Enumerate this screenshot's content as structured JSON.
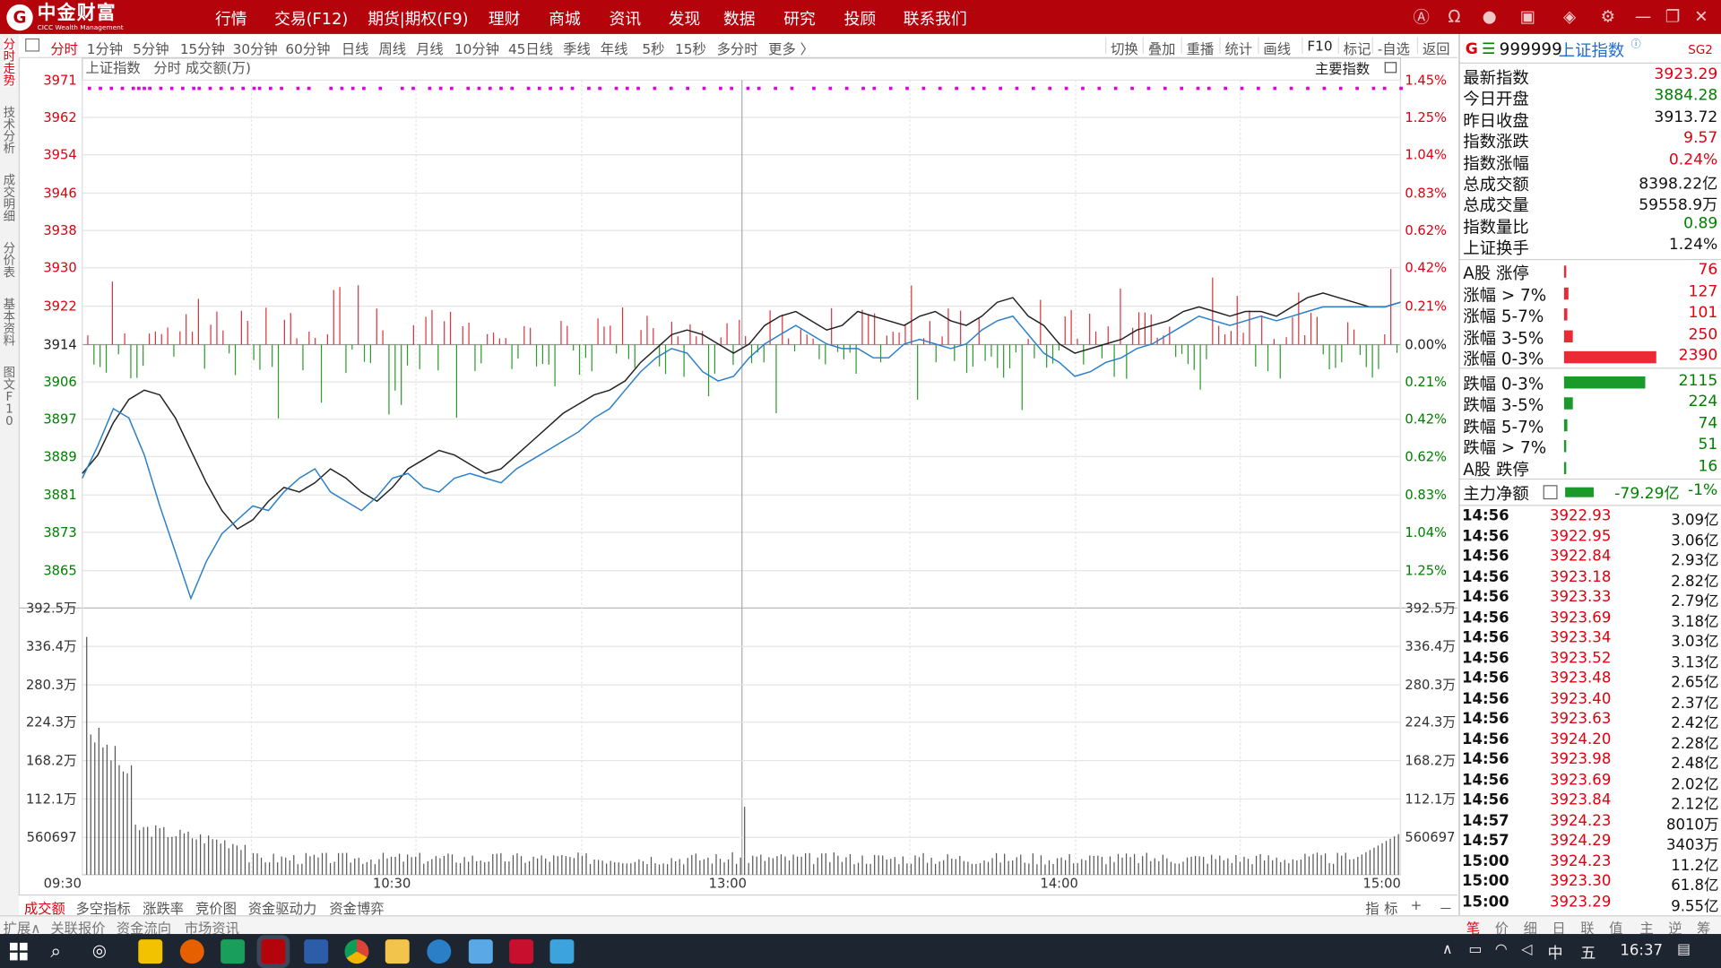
{
  "app": {
    "logo_text": "中金财富",
    "logo_sub": "CICC Wealth Management"
  },
  "menu": [
    "行情",
    "交易(F12)",
    "期货|期权(F9)",
    "理财",
    "商城",
    "资讯",
    "发现",
    "数据",
    "研究",
    "投顾",
    "联系我们"
  ],
  "top_icons": [
    "ai-icon",
    "headset-icon",
    "user-icon",
    "screen-icon",
    "cube-icon",
    "gear-icon",
    "minimize-icon",
    "restore-icon",
    "close-icon"
  ],
  "left_tabs": [
    "分时走势",
    "技术分析",
    "成交明细",
    "分价表",
    "基本资料",
    "图文F10"
  ],
  "period_tabs": [
    "分时",
    "1分钟",
    "5分钟",
    "15分钟",
    "30分钟",
    "60分钟",
    "日线",
    "周线",
    "月线",
    "10分钟",
    "45日线",
    "季线",
    "年线",
    "5秒",
    "15秒",
    "多分时",
    "更多"
  ],
  "right_tools": [
    "切换",
    "叠加",
    "重播",
    "统计",
    "画线",
    "F10",
    "标记",
    "-自选",
    "返回"
  ],
  "chart_header": {
    "name": "上证指数",
    "sub": "分时 成交额(万)",
    "tag": "主要指数"
  },
  "chart_data": {
    "type": "line",
    "title": "上证指数",
    "x_ticks": [
      "09:30",
      "10:30",
      "13:00",
      "14:00",
      "15:00"
    ],
    "y_left_ticks": [
      "3971",
      "3962",
      "3954",
      "3946",
      "3938",
      "3930",
      "3922",
      "3914",
      "3906",
      "3897",
      "3889",
      "3881",
      "3873",
      "3865"
    ],
    "y_right_ticks": [
      "1.45%",
      "1.25%",
      "1.04%",
      "0.83%",
      "0.62%",
      "0.42%",
      "0.21%",
      "0.00%",
      "0.21%",
      "0.42%",
      "0.62%",
      "0.83%",
      "1.04%",
      "1.25%"
    ],
    "prev_close": 3913.72,
    "y_range": [
      3856,
      3971
    ],
    "volume_ticks": [
      "392.5万",
      "336.4万",
      "280.3万",
      "224.3万",
      "168.2万",
      "112.1万",
      "560697"
    ],
    "volume_ylim": [
      0,
      3925000
    ],
    "series": [
      {
        "color": "#222222",
        "values": [
          3886,
          3890,
          3897,
          3902,
          3904,
          3903,
          3898,
          3891,
          3884,
          3878,
          3874,
          3876,
          3880,
          3883,
          3882,
          3884,
          3887,
          3885,
          3882,
          3880,
          3883,
          3887,
          3889,
          3891,
          3890,
          3888,
          3886,
          3887,
          3890,
          3893,
          3896,
          3899,
          3901,
          3903,
          3904,
          3906,
          3910,
          3913,
          3916,
          3917,
          3916,
          3914,
          3912,
          3914,
          3918,
          3920,
          3921,
          3919,
          3917,
          3918,
          3921,
          3920,
          3919,
          3918,
          3920,
          3921,
          3919,
          3918,
          3920,
          3923,
          3924,
          3920,
          3918,
          3914,
          3912,
          3913,
          3914,
          3915,
          3917,
          3918,
          3919,
          3921,
          3922,
          3921,
          3920,
          3921,
          3921,
          3920,
          3922,
          3924,
          3925,
          3924,
          3923,
          3922,
          3922,
          3923
        ]
      },
      {
        "color": "#2a7fc7",
        "values": [
          3885,
          3892,
          3900,
          3898,
          3890,
          3879,
          3869,
          3859,
          3867,
          3873,
          3876,
          3879,
          3878,
          3882,
          3885,
          3887,
          3882,
          3880,
          3878,
          3881,
          3885,
          3886,
          3883,
          3882,
          3885,
          3886,
          3885,
          3884,
          3887,
          3889,
          3891,
          3893,
          3895,
          3898,
          3900,
          3904,
          3908,
          3911,
          3913,
          3912,
          3908,
          3906,
          3907,
          3911,
          3914,
          3916,
          3918,
          3916,
          3914,
          3913,
          3913,
          3911,
          3911,
          3914,
          3915,
          3914,
          3913,
          3914,
          3917,
          3919,
          3920,
          3916,
          3912,
          3910,
          3907,
          3908,
          3910,
          3911,
          3913,
          3914,
          3916,
          3918,
          3920,
          3919,
          3918,
          3919,
          3920,
          3919,
          3920,
          3921,
          3922,
          3922,
          3922,
          3922,
          3922,
          3923
        ]
      }
    ]
  },
  "quote": {
    "flag": "G",
    "code": "999999",
    "name": "上证指数",
    "tag": "SG2",
    "rows": [
      {
        "k": "最新指数",
        "v": "3923.29",
        "c": "red"
      },
      {
        "k": "今日开盘",
        "v": "3884.28",
        "c": "grn"
      },
      {
        "k": "昨日收盘",
        "v": "3913.72",
        "c": ""
      },
      {
        "k": "指数涨跌",
        "v": "9.57",
        "c": "red"
      },
      {
        "k": "指数涨幅",
        "v": "0.24%",
        "c": "red"
      },
      {
        "k": "总成交额",
        "v": "8398.22亿",
        "c": ""
      },
      {
        "k": "总成交量",
        "v": "59558.9万",
        "c": ""
      },
      {
        "k": "指数量比",
        "v": "0.89",
        "c": "grn"
      },
      {
        "k": "上证换手",
        "v": "1.24%",
        "c": ""
      }
    ],
    "breadth": [
      {
        "k": "A股 涨停",
        "v": "76",
        "c": "red",
        "bar": 0.02
      },
      {
        "k": "涨幅 > 7%",
        "v": "127",
        "c": "red",
        "bar": 0.05
      },
      {
        "k": "涨幅 5-7%",
        "v": "101",
        "c": "red",
        "bar": 0.04
      },
      {
        "k": "涨幅 3-5%",
        "v": "250",
        "c": "red",
        "bar": 0.1
      },
      {
        "k": "涨幅 0-3%",
        "v": "2390",
        "c": "red",
        "bar": 1.0
      },
      {
        "k": "跌幅 0-3%",
        "v": "2115",
        "c": "grn",
        "bar": 0.88
      },
      {
        "k": "跌幅 3-5%",
        "v": "224",
        "c": "grn",
        "bar": 0.09
      },
      {
        "k": "跌幅 5-7%",
        "v": "74",
        "c": "grn",
        "bar": 0.03
      },
      {
        "k": "跌幅 > 7%",
        "v": "51",
        "c": "grn",
        "bar": 0.02
      },
      {
        "k": "A股 跌停",
        "v": "16",
        "c": "grn",
        "bar": 0.01
      }
    ],
    "net_flow": {
      "k": "主力净额",
      "v": "-79.29亿",
      "p": "-1%"
    },
    "ticks": [
      {
        "t": "14:56",
        "p": "3922.93",
        "a": "3.09亿"
      },
      {
        "t": "14:56",
        "p": "3922.95",
        "a": "3.06亿"
      },
      {
        "t": "14:56",
        "p": "3922.84",
        "a": "2.93亿"
      },
      {
        "t": "14:56",
        "p": "3923.18",
        "a": "2.82亿"
      },
      {
        "t": "14:56",
        "p": "3923.33",
        "a": "2.79亿"
      },
      {
        "t": "14:56",
        "p": "3923.69",
        "a": "3.18亿"
      },
      {
        "t": "14:56",
        "p": "3923.34",
        "a": "3.03亿"
      },
      {
        "t": "14:56",
        "p": "3923.52",
        "a": "3.13亿"
      },
      {
        "t": "14:56",
        "p": "3923.48",
        "a": "2.65亿"
      },
      {
        "t": "14:56",
        "p": "3923.40",
        "a": "2.37亿"
      },
      {
        "t": "14:56",
        "p": "3923.63",
        "a": "2.42亿"
      },
      {
        "t": "14:56",
        "p": "3924.20",
        "a": "2.28亿"
      },
      {
        "t": "14:56",
        "p": "3923.98",
        "a": "2.48亿"
      },
      {
        "t": "14:56",
        "p": "3923.69",
        "a": "2.02亿"
      },
      {
        "t": "14:56",
        "p": "3923.84",
        "a": "2.12亿"
      },
      {
        "t": "14:57",
        "p": "3924.23",
        "a": "8010万"
      },
      {
        "t": "14:57",
        "p": "3924.29",
        "a": "3403万"
      },
      {
        "t": "15:00",
        "p": "3924.23",
        "a": "11.2亿"
      },
      {
        "t": "15:00",
        "p": "3923.30",
        "a": "61.8亿"
      },
      {
        "t": "15:00",
        "p": "3923.29",
        "a": "9.55亿"
      }
    ]
  },
  "bottom_tabs": [
    "成交额",
    "多空指标",
    "涨跌率",
    "竞价图",
    "资金驱动力",
    "资金博弈"
  ],
  "bottom_right": [
    "指",
    "标",
    "+",
    "－"
  ],
  "bottom_strip": [
    "扩展∧",
    "关联报价",
    "资金流向",
    "市场资讯"
  ],
  "bottom_strip_right": [
    "笔",
    "价",
    "细",
    "日",
    "联",
    "值",
    "主",
    "逆",
    "筹"
  ],
  "taskbar": {
    "time": "16:37",
    "ime": "中",
    "ime2": "五"
  }
}
